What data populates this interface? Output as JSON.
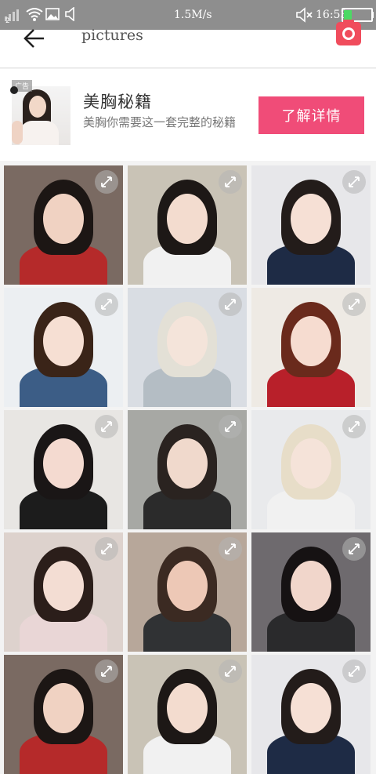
{
  "status_bar": {
    "sim_label": "2",
    "network_speed": "1.5M/s",
    "time": "16:53",
    "battery_level": 0.28,
    "icons": [
      "signal-icon",
      "wifi-icon",
      "image-icon",
      "sound-icon",
      "mute-icon",
      "battery-icon"
    ]
  },
  "header": {
    "title": "pictures",
    "back_icon": "arrow-left-icon",
    "camera_icon": "camera-icon",
    "accent_color": "#f04c5c"
  },
  "ad": {
    "tag": "广告",
    "title": "美胸秘籍",
    "description": "美胸你需要这一套完整的秘籍",
    "cta_label": "了解详情",
    "cta_color": "#f04c78"
  },
  "gallery": {
    "expand_icon": "expand-icon",
    "photos": [
      {
        "bg": "#7a6a62",
        "hair": "#1c1614",
        "face": "#f0d2c2",
        "body": "#b52a2a"
      },
      {
        "bg": "#c9c3b6",
        "hair": "#1d1816",
        "face": "#f3dccf",
        "body": "#f1f1f1"
      },
      {
        "bg": "#e7e7ea",
        "hair": "#231c1a",
        "face": "#f6e0d5",
        "body": "#1e2b45"
      },
      {
        "bg": "#eceff2",
        "hair": "#3a2418",
        "face": "#f6dfd3",
        "body": "#3c5d86"
      },
      {
        "bg": "#d9dde3",
        "hair": "#e3e0d6",
        "face": "#f4e4da",
        "body": "#b4bdc4"
      },
      {
        "bg": "#eeeae4",
        "hair": "#6a2a1c",
        "face": "#f6dcd0",
        "body": "#b8202a"
      },
      {
        "bg": "#e8e6e3",
        "hair": "#1a1616",
        "face": "#f4dad0",
        "body": "#1c1c1c"
      },
      {
        "bg": "#a7a8a4",
        "hair": "#2a2320",
        "face": "#f0d9cc",
        "body": "#2b2b2b"
      },
      {
        "bg": "#e9eaec",
        "hair": "#e7ddc8",
        "face": "#f5e3d9",
        "body": "#f1f1f1"
      },
      {
        "bg": "#ddd2cd",
        "hair": "#2b1e1a",
        "face": "#f3ddd3",
        "body": "#e9d6d6"
      },
      {
        "bg": "#b7a79a",
        "hair": "#3b2a22",
        "face": "#edc8b6",
        "body": "#303234"
      },
      {
        "bg": "#6e6a6e",
        "hair": "#161213",
        "face": "#f1d6cb",
        "body": "#2a2a2c"
      }
    ]
  }
}
